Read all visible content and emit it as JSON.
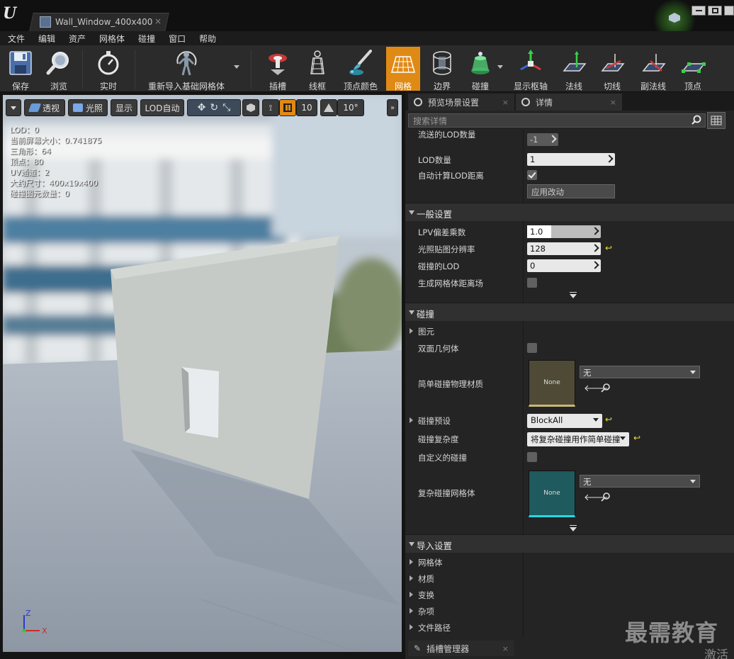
{
  "window": {
    "tab_title": "Wall_Window_400x400",
    "tab_close": "×"
  },
  "menu": [
    "文件",
    "编辑",
    "资产",
    "网格体",
    "碰撞",
    "窗口",
    "帮助"
  ],
  "toolbar": {
    "save": "保存",
    "browse": "浏览",
    "realtime": "实时",
    "reimport": "重新导入基础网格体",
    "socket": "插槽",
    "wireframe": "线框",
    "vertex_color": "顶点颜色",
    "grid": "网格",
    "bounds": "边界",
    "collision": "碰撞",
    "pivot": "显示枢轴",
    "normals": "法线",
    "tangents": "切线",
    "binormals": "副法线",
    "vertices": "顶点",
    "accent_color": "#e08a16"
  },
  "viewport": {
    "perspective": "透视",
    "lit": "光照",
    "show": "显示",
    "lod_auto": "LOD自动",
    "grid_size": "10",
    "rot_size": "10°",
    "stats": [
      "LOD：0",
      "当前屏幕大小：0.741875",
      "三角形：64",
      "顶点：80",
      "UV通道：2",
      "大约尺寸：400x19x400",
      "碰撞图元数量：0"
    ],
    "axis_z": "Z",
    "axis_x": "X"
  },
  "panel": {
    "tab_preview": "预览场景设置",
    "tab_details": "详情",
    "search_placeholder": "搜索详情",
    "rows": {
      "streamed_lod": "流送的LOD数量",
      "streamed_lod_value": "-1",
      "lod_count": "LOD数量",
      "lod_count_value": "1",
      "auto_lod": "自动计算LOD距离",
      "apply": "应用改动",
      "general": "一般设置",
      "lpv": "LPV偏差乘数",
      "lpv_value": "1.0",
      "lightmap_res": "光照贴图分辨率",
      "lightmap_res_value": "128",
      "lod_for_collision": "碰撞的LOD",
      "lod_for_collision_value": "0",
      "gen_distance_field": "生成网格体距离场",
      "collision": "碰撞",
      "primitives": "图元",
      "double_sided": "双面几何体",
      "simple_phys_mat": "简单碰撞物理材质",
      "thumb_none": "None",
      "none_option": "无",
      "collision_preset": "碰撞预设",
      "collision_preset_value": "BlockAll",
      "collision_complexity": "碰撞复杂度",
      "collision_complexity_value": "将复杂碰撞用作简单碰撞",
      "custom_collision": "自定义的碰撞",
      "complex_collision_mesh": "复杂碰撞网格体",
      "import_settings": "导入设置",
      "mesh": "网格体",
      "material": "材质",
      "transform": "变换",
      "misc": "杂项",
      "file_path": "文件路径"
    },
    "socket_manager": "插槽管理器"
  },
  "watermark": {
    "main": "最需教育",
    "sub": "激活"
  }
}
